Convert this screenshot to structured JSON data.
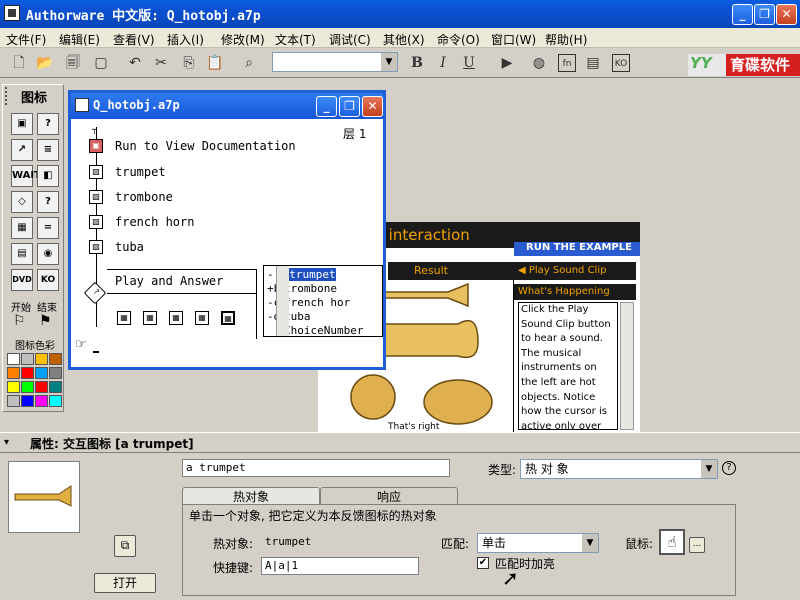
{
  "app": {
    "title": "Authorware 中文版: Q_hotobj.a7p",
    "minimize": "_",
    "restore": "❐",
    "close": "✕"
  },
  "menu": [
    "文件(F)",
    "编辑(E)",
    "查看(V)",
    "插入(I)",
    "修改(M)",
    "文本(T)",
    "调试(C)",
    "其他(X)",
    "命令(O)",
    "窗口(W)",
    "帮助(H)"
  ],
  "toolbar": {
    "bold": "B",
    "italic": "I",
    "underline": "U",
    "style_combo": "",
    "brand_mark": "YY",
    "brand_name": "育碟软件"
  },
  "palette": {
    "title": "图标",
    "start_label": "开始",
    "end_label": "结束",
    "color_label": "图标色彩",
    "icons": [
      "display",
      "motion",
      "erase",
      "wait",
      "navigate",
      "framework",
      "decision",
      "interaction",
      "calculate",
      "map",
      "digital-movie",
      "sound",
      "dvd",
      "knowledge-object"
    ],
    "icon_glyphs": [
      "▣",
      "?",
      "↗",
      "≡",
      "WAIT",
      "◧",
      "◇",
      "?",
      "▦",
      "=",
      "▤",
      "◉",
      "DVD",
      "KO"
    ],
    "swatches": [
      "#ffffff",
      "#c0c0c0",
      "#ffc000",
      "#c06000",
      "#ff8000",
      "#ff0000",
      "#00a0ff",
      "#808080",
      "#ffff00",
      "#00ff00",
      "#ff0000",
      "#008080",
      "#c0c0c0",
      "#0000ff",
      "#ff00ff",
      "#00ffff"
    ]
  },
  "design_window": {
    "title": "Q_hotobj.a7p",
    "layer": "层 1",
    "items": [
      "Run to View Documentation",
      "trumpet",
      "trombone",
      "french horn",
      "tuba"
    ],
    "interaction_label": "Play and Answer",
    "responses": [
      {
        "key": "-",
        "label": "a trumpet"
      },
      {
        "key": "+b",
        "label": "trombone"
      },
      {
        "key": "-c",
        "label": "french hor"
      },
      {
        "key": "-d",
        "label": "tuba"
      },
      {
        "key": "",
        "label": "ChoiceNumber"
      }
    ]
  },
  "presentation": {
    "title": "t interaction",
    "run_label": "RUN THE EXAMPLE",
    "result_label": "Result",
    "play_label": "◀ Play Sound Clip",
    "happening_label": "What's Happening",
    "happening_text": "Click the Play Sound Clip button to hear a sound. The musical instruments on the left are hot objects. Notice how the cursor is active only over",
    "caption": "That's right"
  },
  "properties": {
    "title": "属性: 交互图标 [a trumpet]",
    "name_value": "a trumpet",
    "type_label": "类型:",
    "type_value": "热 对 象",
    "help": "?",
    "tabs": [
      "热对象",
      "响应"
    ],
    "description": "单击一个对象, 把它定义为本反馈图标的热对象",
    "hot_object_label": "热对象:",
    "hot_object_value": "trumpet",
    "shortcut_label": "快捷键:",
    "shortcut_value": "A|a|1",
    "match_label": "匹配:",
    "match_value": "单击",
    "cursor_label": "鼠标:",
    "cursor_btn": "...",
    "highlight_label": "匹配时加亮",
    "highlight_checked": "✔",
    "open_button": "打开"
  }
}
